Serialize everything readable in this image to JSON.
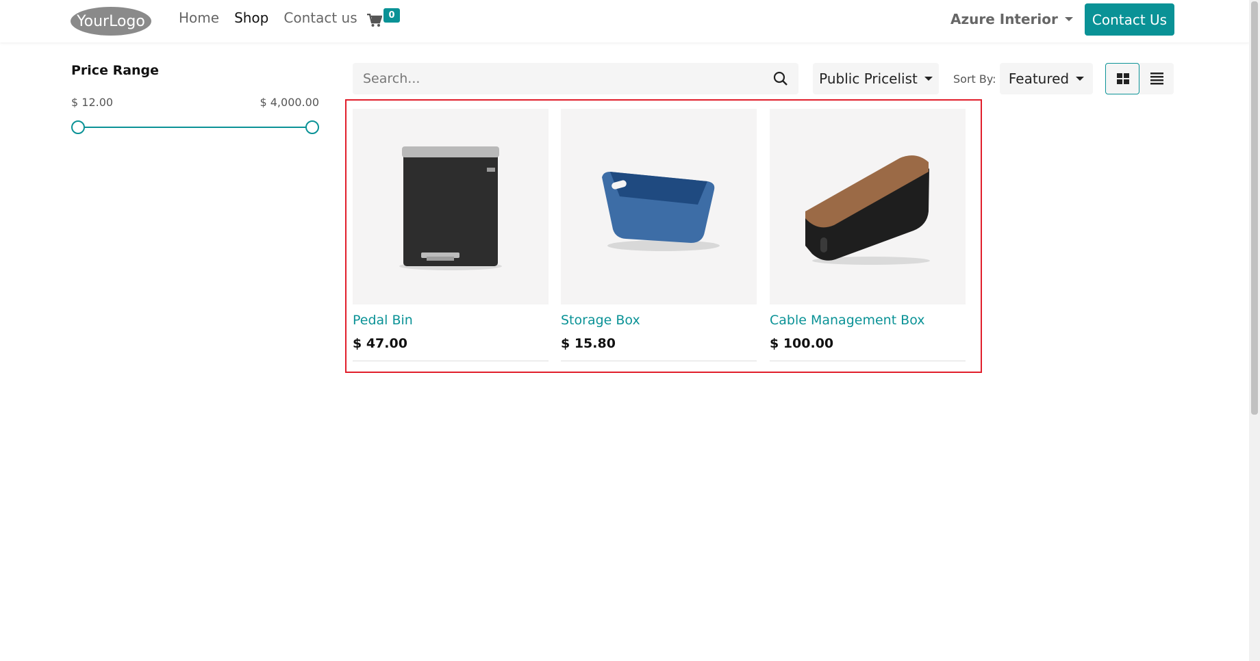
{
  "header": {
    "logo_text": "YourLogo",
    "nav": [
      {
        "label": "Home",
        "active": false
      },
      {
        "label": "Shop",
        "active": true
      },
      {
        "label": "Contact us",
        "active": false
      }
    ],
    "cart_count": "0",
    "company": "Azure Interior",
    "contact_button": "Contact Us"
  },
  "sidebar": {
    "title": "Price Range",
    "min_label": "$ 12.00",
    "max_label": "$ 4,000.00"
  },
  "toolbar": {
    "search_placeholder": "Search...",
    "pricelist": "Public Pricelist",
    "sort_label": "Sort By:",
    "sort_value": "Featured"
  },
  "products": [
    {
      "name": "Pedal Bin",
      "price": "$ 47.00"
    },
    {
      "name": "Storage Box",
      "price": "$ 15.80"
    },
    {
      "name": "Cable Management Box",
      "price": "$ 100.00"
    }
  ],
  "colors": {
    "accent": "#0a9296",
    "highlight_border": "#e11d2a"
  }
}
